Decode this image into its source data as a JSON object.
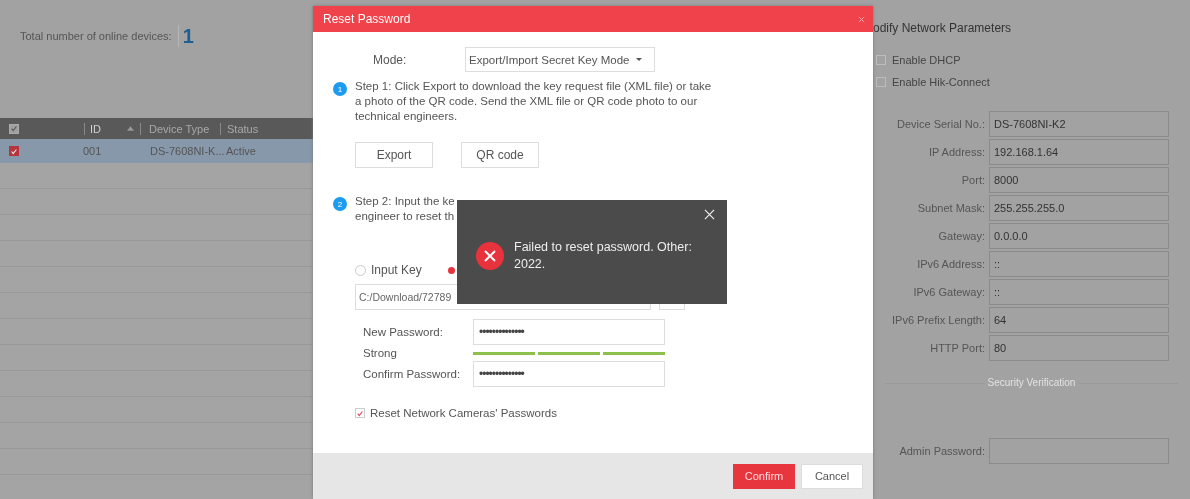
{
  "device_list": {
    "total_label": "Total number of online devices:",
    "total_count": "1",
    "header_checked": true,
    "columns": [
      {
        "label": "ID",
        "sorted": true
      },
      {
        "label": "Device Type",
        "sorted": false
      },
      {
        "label": "Status",
        "sorted": false
      }
    ],
    "rows": [
      {
        "selected": true,
        "checked": true,
        "cells": [
          "001",
          "DS-7608NI-K...",
          "Active"
        ]
      }
    ]
  },
  "dialog": {
    "title": "Reset Password",
    "mode_label": "Mode:",
    "mode_value": "Export/Import Secret Key Mode",
    "steps": [
      {
        "number": "1",
        "lines": [
          "Step 1: Click Export to download the key request file (XML file) or take a photo of the QR code. Send the XML file or QR code photo to our technical engineers."
        ],
        "buttons": [
          "Export",
          "QR code"
        ]
      },
      {
        "number": "2",
        "lines": [
          "Step 2: Input the ke",
          "engineer to reset th"
        ]
      }
    ],
    "key_options": [
      {
        "label": "Input Key",
        "selected": false
      },
      {
        "selected": true
      }
    ],
    "file_path": "C:/Download/72789",
    "password_fields": [
      {
        "label": "New Password:",
        "value": "••••••••••••••"
      },
      {
        "label": "Confirm Password:",
        "value": "••••••••••••••"
      }
    ],
    "strength": {
      "label": "Strong",
      "level": 1
    },
    "reset_cameras": {
      "label": "Reset Network Cameras' Passwords",
      "checked": true
    },
    "buttons": [
      {
        "label": "Confirm",
        "kind": "primary"
      },
      {
        "label": "Cancel",
        "kind": "secondary"
      }
    ]
  },
  "toast": {
    "message": "Failed to reset password. Other: 2022."
  },
  "network_panel": {
    "title": "odify Network Parameters",
    "options": [
      {
        "label": "Enable DHCP",
        "checked": false
      },
      {
        "label": "Enable Hik-Connect",
        "checked": false
      }
    ],
    "fields": [
      {
        "label": "Device Serial No.:",
        "value": "DS-7608NI-K2"
      },
      {
        "label": "IP Address:",
        "value": "192.168.1.64"
      },
      {
        "label": "Port:",
        "value": "8000"
      },
      {
        "label": "Subnet Mask:",
        "value": "255.255.255.0"
      },
      {
        "label": "Gateway:",
        "value": "0.0.0.0"
      },
      {
        "label": "IPv6 Address:",
        "value": "::"
      },
      {
        "label": "IPv6 Gateway:",
        "value": "::"
      },
      {
        "label": "IPv6 Prefix Length:",
        "value": "64"
      },
      {
        "label": "HTTP Port:",
        "value": "80"
      }
    ],
    "section_title": "Security Verification",
    "admin_label": "Admin Password:"
  }
}
